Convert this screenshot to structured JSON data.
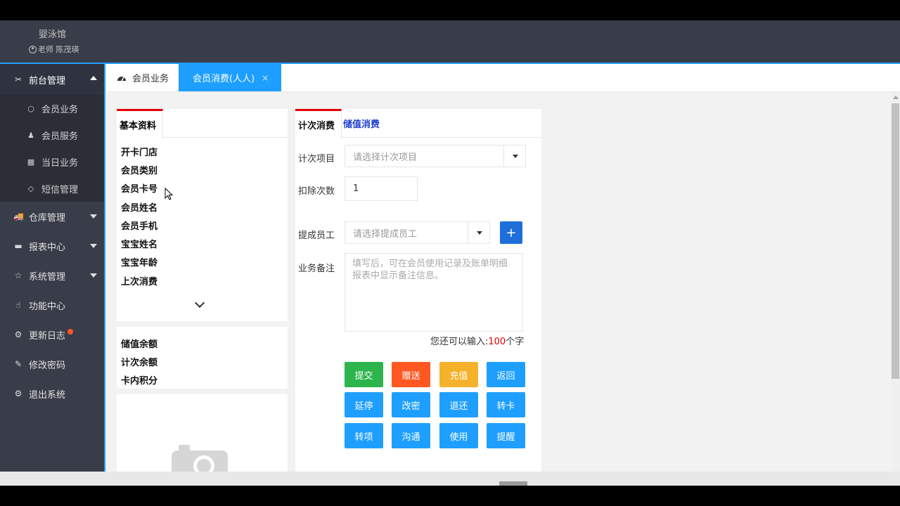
{
  "header": {
    "brand": "婴泳馆",
    "user": "老师 陈茂瑛"
  },
  "sidebar": {
    "items": [
      {
        "label": "前台管理",
        "icon": "wrench-icon",
        "glyph": "✂",
        "expanded": true
      },
      {
        "label": "仓库管理",
        "icon": "warehouse-icon",
        "glyph": "🚚"
      },
      {
        "label": "报表中心",
        "icon": "report-icon",
        "glyph": "▬"
      },
      {
        "label": "系统管理",
        "icon": "star-icon",
        "glyph": "☆"
      },
      {
        "label": "功能中心",
        "icon": "function-icon",
        "glyph": "☝"
      },
      {
        "label": "更新日志",
        "icon": "gears-icon",
        "glyph": "⚙"
      },
      {
        "label": "修改密码",
        "icon": "edit-icon",
        "glyph": "✎"
      },
      {
        "label": "退出系统",
        "icon": "exit-icon",
        "glyph": "⚙"
      }
    ],
    "sub_items": [
      {
        "label": "会员业务",
        "glyph": "○"
      },
      {
        "label": "会员服务",
        "glyph": "♟"
      },
      {
        "label": "当日业务",
        "glyph": "▦"
      },
      {
        "label": "短信管理",
        "glyph": "◇"
      }
    ]
  },
  "tabs": {
    "home": "会员业务",
    "active": "会员消费(人人)",
    "close": "×"
  },
  "left_panel": {
    "tab_label": "基本资料",
    "fields": [
      "开卡门店",
      "会员类别",
      "会员卡号",
      "会员姓名",
      "会员手机",
      "宝宝姓名",
      "宝宝年龄",
      "上次消费"
    ],
    "balances": [
      "储值余额",
      "计次余额",
      "卡内积分"
    ]
  },
  "right_panel": {
    "tabs": {
      "count": "计次消费",
      "stored": "储值消费"
    },
    "item_label": "计次项目",
    "item_placeholder": "请选择计次项目",
    "deduct_label": "扣除次数",
    "deduct_value": "1",
    "staff_label": "提成员工",
    "staff_placeholder": "请选择提成员工",
    "plus": "+",
    "note_label": "业务备注",
    "note_placeholder": "填写后，可在会员使用记录及账单明细报表中显示备注信息。",
    "counter_prefix": "您还可以输入:",
    "counter_num": "100",
    "counter_suffix": "个字"
  },
  "buttons": [
    {
      "label": "提交",
      "color": "#2db54c"
    },
    {
      "label": "赠送",
      "color": "#ff5722"
    },
    {
      "label": "充值",
      "color": "#f6b12a"
    },
    {
      "label": "返回",
      "color": "#1e9fff"
    },
    {
      "label": "延停",
      "color": "#1e9fff"
    },
    {
      "label": "改密",
      "color": "#1e9fff"
    },
    {
      "label": "退还",
      "color": "#1e9fff"
    },
    {
      "label": "转卡",
      "color": "#1e9fff"
    },
    {
      "label": "转项",
      "color": "#1e9fff"
    },
    {
      "label": "沟通",
      "color": "#1e9fff"
    },
    {
      "label": "使用",
      "color": "#1e9fff"
    },
    {
      "label": "提醒",
      "color": "#1e9fff"
    }
  ]
}
